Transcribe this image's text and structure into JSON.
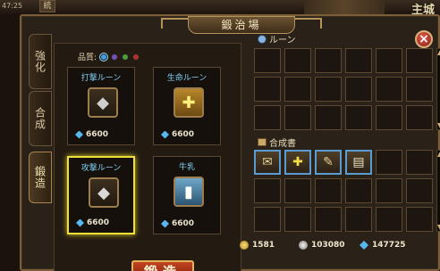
{
  "topbar": {
    "clock": "47:25",
    "left_glyph": "統",
    "right_text": "主城"
  },
  "window": {
    "title": "鍛治場",
    "close_label": "×"
  },
  "tabs": [
    {
      "label": "強化"
    },
    {
      "label": "合成"
    },
    {
      "label": "鍛造",
      "active": true
    }
  ],
  "left": {
    "quality_label": "品質:",
    "quality_colors": [
      "#3aa0ea",
      "#7a4fb5",
      "#4f9b3c",
      "#b0302a"
    ],
    "cards": [
      {
        "title": "打撃ルーン",
        "icon": "hammer-rune-icon",
        "price": "6600",
        "selected": false
      },
      {
        "title": "生命ルーン",
        "icon": "life-rune-icon",
        "price": "6600",
        "selected": false
      },
      {
        "title": "攻撃ルーン",
        "icon": "attack-rune-icon",
        "price": "6600",
        "selected": true
      },
      {
        "title": "牛乳",
        "icon": "milk-icon",
        "price": "6600",
        "selected": false
      }
    ],
    "forge_button": "鍛造"
  },
  "right": {
    "rune_section": "ルーン",
    "book_section": "合成書",
    "book_items": [
      "scroll-icon",
      "yellow-rune-icon",
      "quill-icon",
      "scroll-icon"
    ]
  },
  "currency": {
    "gold": "1581",
    "silver": "103080",
    "crystal": "147725"
  },
  "colors": {
    "accent_gold": "#b4935b",
    "price_blue": "#57b7ef",
    "selected_border": "#f0e13a",
    "forge_red": "#c2431f"
  }
}
